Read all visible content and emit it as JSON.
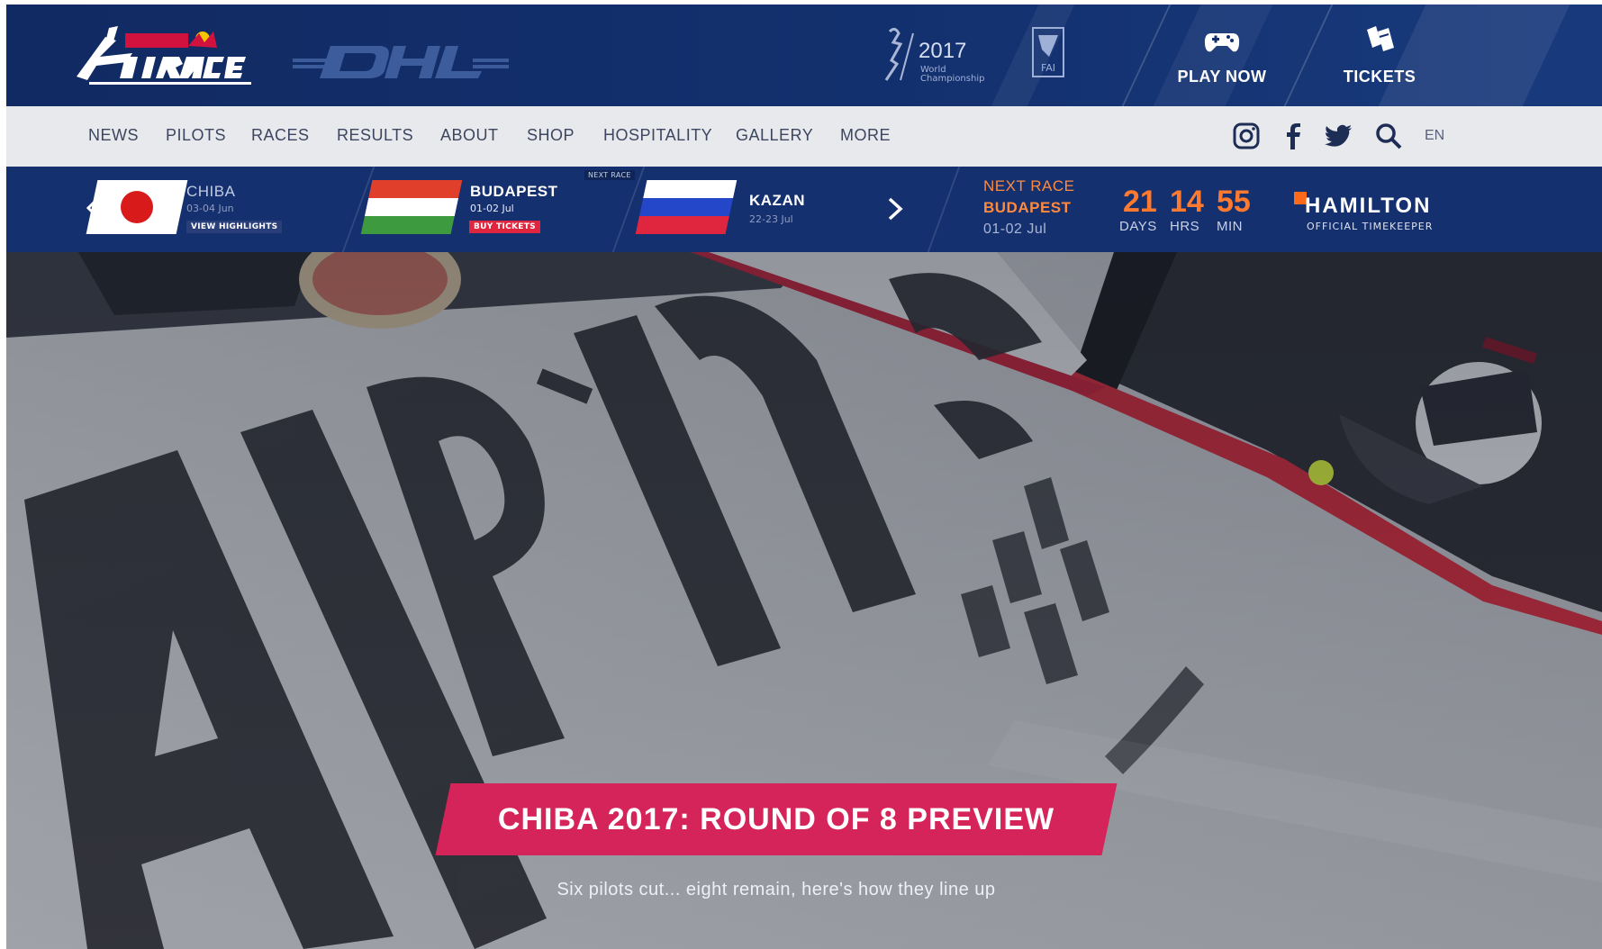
{
  "header": {
    "brand_logo_text": "Red Bull AIR RACE",
    "sponsor_logo_text": "DHL",
    "badge_year": "2017",
    "badge_sub": "World Championship",
    "fai_text": "FAI",
    "play_label": "PLAY NOW",
    "tickets_label": "TICKETS"
  },
  "nav": {
    "items": [
      "NEWS",
      "PILOTS",
      "RACES",
      "RESULTS",
      "ABOUT",
      "SHOP",
      "HOSPITALITY",
      "GALLERY",
      "MORE"
    ],
    "lang": "EN"
  },
  "races": {
    "prev": {
      "city": "CHIBA",
      "date": "03-04 Jun",
      "link": "VIEW HIGHLIGHTS"
    },
    "next": {
      "tag": "NEXT RACE",
      "city": "BUDAPEST",
      "date": "01-02 Jul",
      "link": "BUY TICKETS"
    },
    "upcoming": {
      "city": "KAZAN",
      "date": "22-23 Jul"
    }
  },
  "countdown": {
    "label": "NEXT RACE",
    "city": "BUDAPEST",
    "date": "01-02 Jul",
    "days": "21",
    "hrs": "14",
    "min": "55",
    "days_label": "DAYS",
    "hrs_label": "HRS",
    "min_label": "MIN"
  },
  "timekeeper": {
    "brand": "HAMILTON",
    "sub": "OFFICIAL TIMEKEEPER"
  },
  "hero": {
    "headline": "CHIBA 2017: ROUND OF 8 PREVIEW",
    "subhead": "Six pilots cut... eight remain, here's how they line up"
  },
  "colors": {
    "navy": "#13306e",
    "accent_pink": "#d5245a",
    "countdown_orange": "#ff7a2e",
    "next_race_orange": "#ff8a3d"
  }
}
